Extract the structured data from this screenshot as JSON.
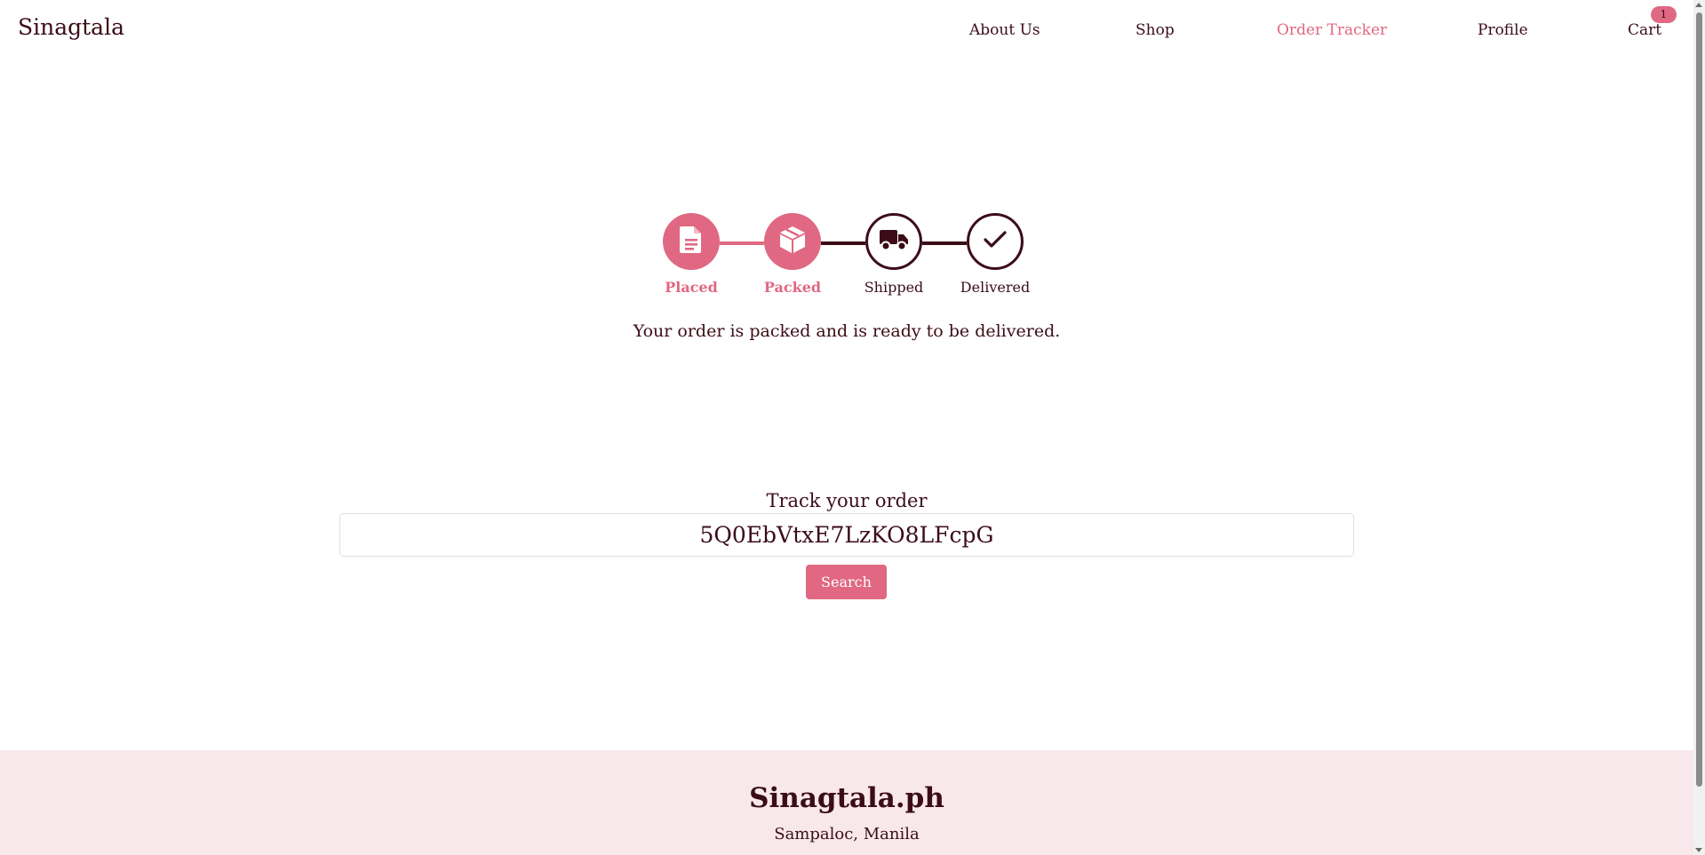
{
  "brand": "Sinagtala",
  "nav": {
    "about": "About Us",
    "shop": "Shop",
    "tracker": "Order Tracker",
    "profile": "Profile",
    "cart": "Cart",
    "cart_count": "1"
  },
  "tracker": {
    "steps": [
      {
        "label": "Placed",
        "state": "done",
        "icon": "document-icon"
      },
      {
        "label": "Packed",
        "state": "done",
        "icon": "box-icon"
      },
      {
        "label": "Shipped",
        "state": "pending",
        "icon": "truck-icon"
      },
      {
        "label": "Delivered",
        "state": "pending",
        "icon": "check-icon"
      }
    ],
    "status_message": "Your order is packed and is ready to be delivered."
  },
  "search": {
    "title": "Track your order",
    "value": "5Q0EbVtxE7LzKO8LFcpG",
    "button": "Search"
  },
  "footer": {
    "title": "Sinagtala.ph",
    "address": "Sampaloc, Manila"
  },
  "colors": {
    "accent": "#e06882",
    "text": "#3b0d18",
    "footer_bg": "#f8e8ec"
  }
}
